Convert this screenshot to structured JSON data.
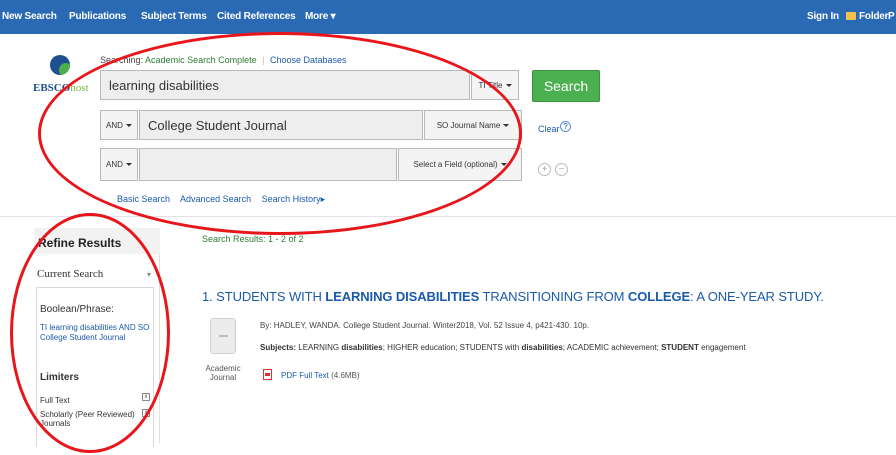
{
  "topnav": {
    "items": [
      "New Search",
      "Publications",
      "Subject Terms",
      "Cited References",
      "More ▾"
    ],
    "sign_in": "Sign In",
    "folder": "Folder",
    "cut_item": "P"
  },
  "logo": {
    "text_main": "EBSCO",
    "text_host": "host"
  },
  "search": {
    "searching_label": "Searching:",
    "database": "Academic Search Complete",
    "choose_databases": "Choose Databases",
    "rows": [
      {
        "operator": "",
        "value": "learning disabilities",
        "field": "TI Title"
      },
      {
        "operator": "AND",
        "value": "College Student Journal",
        "field": "SO Journal Name"
      },
      {
        "operator": "AND",
        "value": "",
        "field": "Select a Field (optional)"
      }
    ],
    "button": "Search",
    "clear": "Clear",
    "help": "?",
    "add": "+",
    "remove": "−",
    "links": [
      "Basic Search",
      "Advanced Search",
      "Search History▸"
    ]
  },
  "refine": {
    "title": "Refine Results",
    "current_search": "Current Search",
    "boolean_label": "Boolean/Phrase:",
    "boolean_value": "TI learning disabilities AND SO College Student Journal",
    "limiters_label": "Limiters",
    "limiters": [
      "Full Text",
      "Scholarly (Peer Reviewed) Journals"
    ],
    "remove_glyph": "x"
  },
  "results": {
    "count": "Search Results: 1 - 2 of 2",
    "items": [
      {
        "number": "1.",
        "title_parts": [
          "STUDENTS WITH ",
          "LEARNING DISABILITIES",
          " TRANSITIONING FROM ",
          "COLLEGE",
          ": A ONE-YEAR STUDY."
        ],
        "byline": "By: HADLEY, WANDA. College Student Journal. Winter2018, Vol. 52 Issue 4, p421-430. 10p.",
        "subjects_label": "Subjects:",
        "subjects_parts": [
          " LEARNING ",
          "disabilities",
          "; HIGHER education; STUDENTS with ",
          "disabilities",
          "; ACADEMIC achievement; ",
          "STUDENT",
          " engagement"
        ],
        "type": "Academic Journal",
        "pdf_label": "PDF Full Text",
        "pdf_size": "(4.6MB)"
      }
    ]
  },
  "colors": {
    "topbar": "#2a6ab5",
    "search_button": "#4caf50",
    "link": "#1a5aab",
    "annotation_red": "#e8161b"
  }
}
